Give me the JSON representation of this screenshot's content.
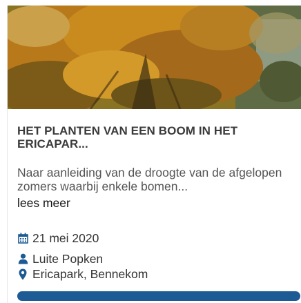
{
  "card": {
    "title": "HET PLANTEN VAN EEN BOOM IN HET ERICAPAR...",
    "excerpt": "Naar aanleiding van de droogte van de afgelopen zomers waarbij enkele bomen...",
    "read_more": "lees meer",
    "date": "21 mei 2020",
    "author": "Luite Popken",
    "location": "Ericapark, Bennekom",
    "image_icon": "autumn-tree-photo",
    "date_icon": "calendar-icon",
    "author_icon": "person-icon",
    "location_icon": "map-pin-icon"
  },
  "colors": {
    "accent": "#1d5b94",
    "title": "#3a3a3a",
    "text": "#555555"
  }
}
